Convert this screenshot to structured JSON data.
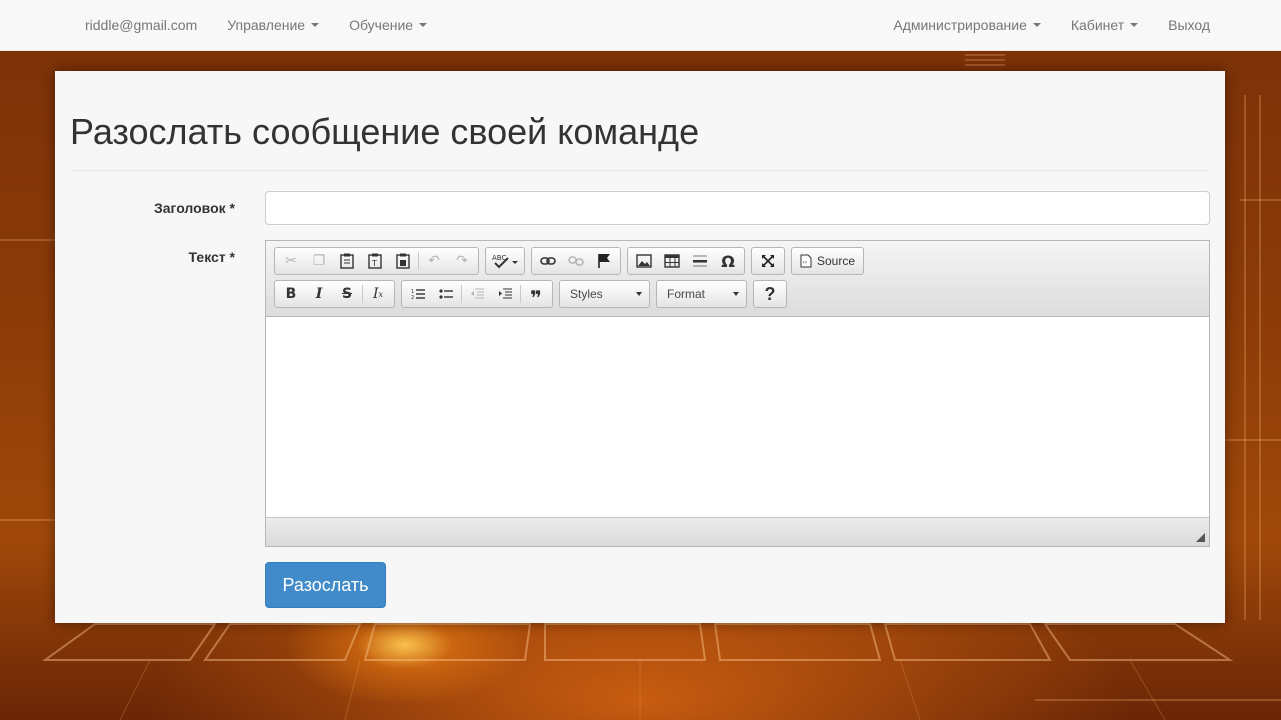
{
  "navbar": {
    "user_email": "riddle@gmail.com",
    "left_menu": [
      {
        "label": "Управление"
      },
      {
        "label": "Обучение"
      }
    ],
    "right_menu": [
      {
        "label": "Администрирование"
      },
      {
        "label": "Кабинет"
      }
    ],
    "logout_label": "Выход"
  },
  "page": {
    "title": "Разослать сообщение своей команде"
  },
  "form": {
    "title_label": "Заголовок *",
    "title_value": "",
    "text_label": "Текст *",
    "submit_label": "Разослать"
  },
  "editor": {
    "toolbar_row1": [
      [
        "cut-icon",
        "copy-icon",
        "paste-icon",
        "paste-text-icon",
        "paste-word-icon"
      ],
      [
        "undo-icon",
        "redo-icon"
      ],
      [
        "spellcheck-icon"
      ],
      [
        "link-icon",
        "unlink-icon",
        "anchor-icon"
      ],
      [
        "image-icon",
        "table-icon",
        "horizontal-rule-icon",
        "special-char-icon"
      ],
      [
        "maximize-icon"
      ],
      [
        "source-icon"
      ]
    ],
    "source_label": "Source",
    "styles_label": "Styles",
    "format_label": "Format",
    "help_label": "?"
  },
  "colors": {
    "navbar_bg": "#f8f8f8",
    "primary_button": "#428bca",
    "background_accent": "#a0480a"
  }
}
